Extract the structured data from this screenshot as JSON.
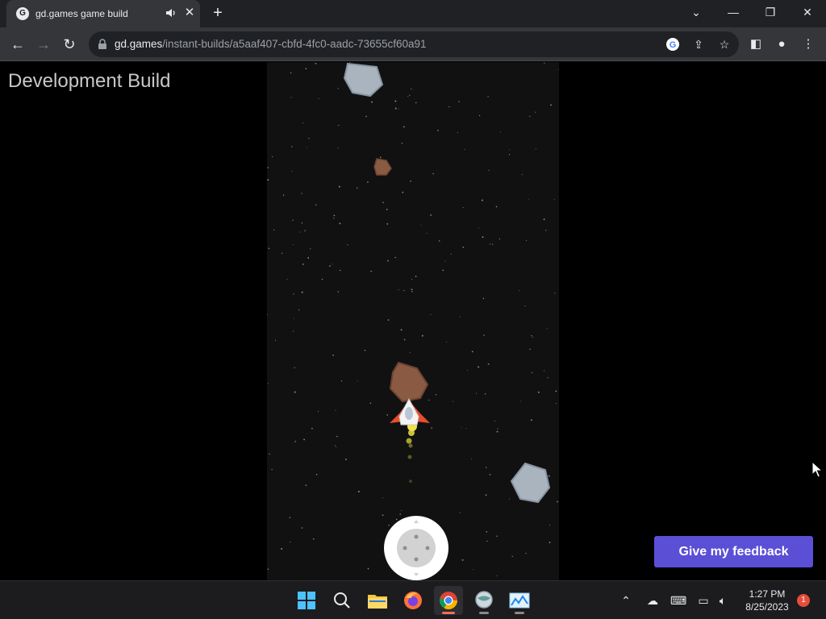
{
  "browser": {
    "tab": {
      "title": "gd.games game build",
      "favicon": "gd-games-logo",
      "audio_icon": "speaker-icon"
    },
    "url": {
      "host": "gd.games",
      "path": "/instant-builds/a5aaf407-cbfd-4fc0-aadc-73655cf60a91"
    },
    "omnibox_icons": [
      "google-icon",
      "share-icon",
      "star-icon"
    ],
    "toolbar_icons": [
      "side-panel-icon",
      "profile-icon",
      "menu-icon"
    ]
  },
  "page": {
    "label": "Development Build",
    "feedback_button": "Give my feedback"
  },
  "game": {
    "background": "#111112",
    "objects": [
      "large-gray-asteroid",
      "small-brown-asteroid",
      "brown-asteroid",
      "spaceship",
      "gray-asteroid",
      "virtual-joystick"
    ]
  },
  "taskbar": {
    "apps": [
      "windows-start",
      "search",
      "file-explorer",
      "firefox",
      "chrome",
      "globe-app",
      "photos-app"
    ],
    "active_app": "chrome",
    "clock": {
      "time": "1:27 PM",
      "date": "8/25/2023"
    },
    "notification_count": "1"
  },
  "colors": {
    "accent": "#5b4fd6",
    "chrome_bg": "#35363a",
    "tabbar_bg": "#202124"
  }
}
